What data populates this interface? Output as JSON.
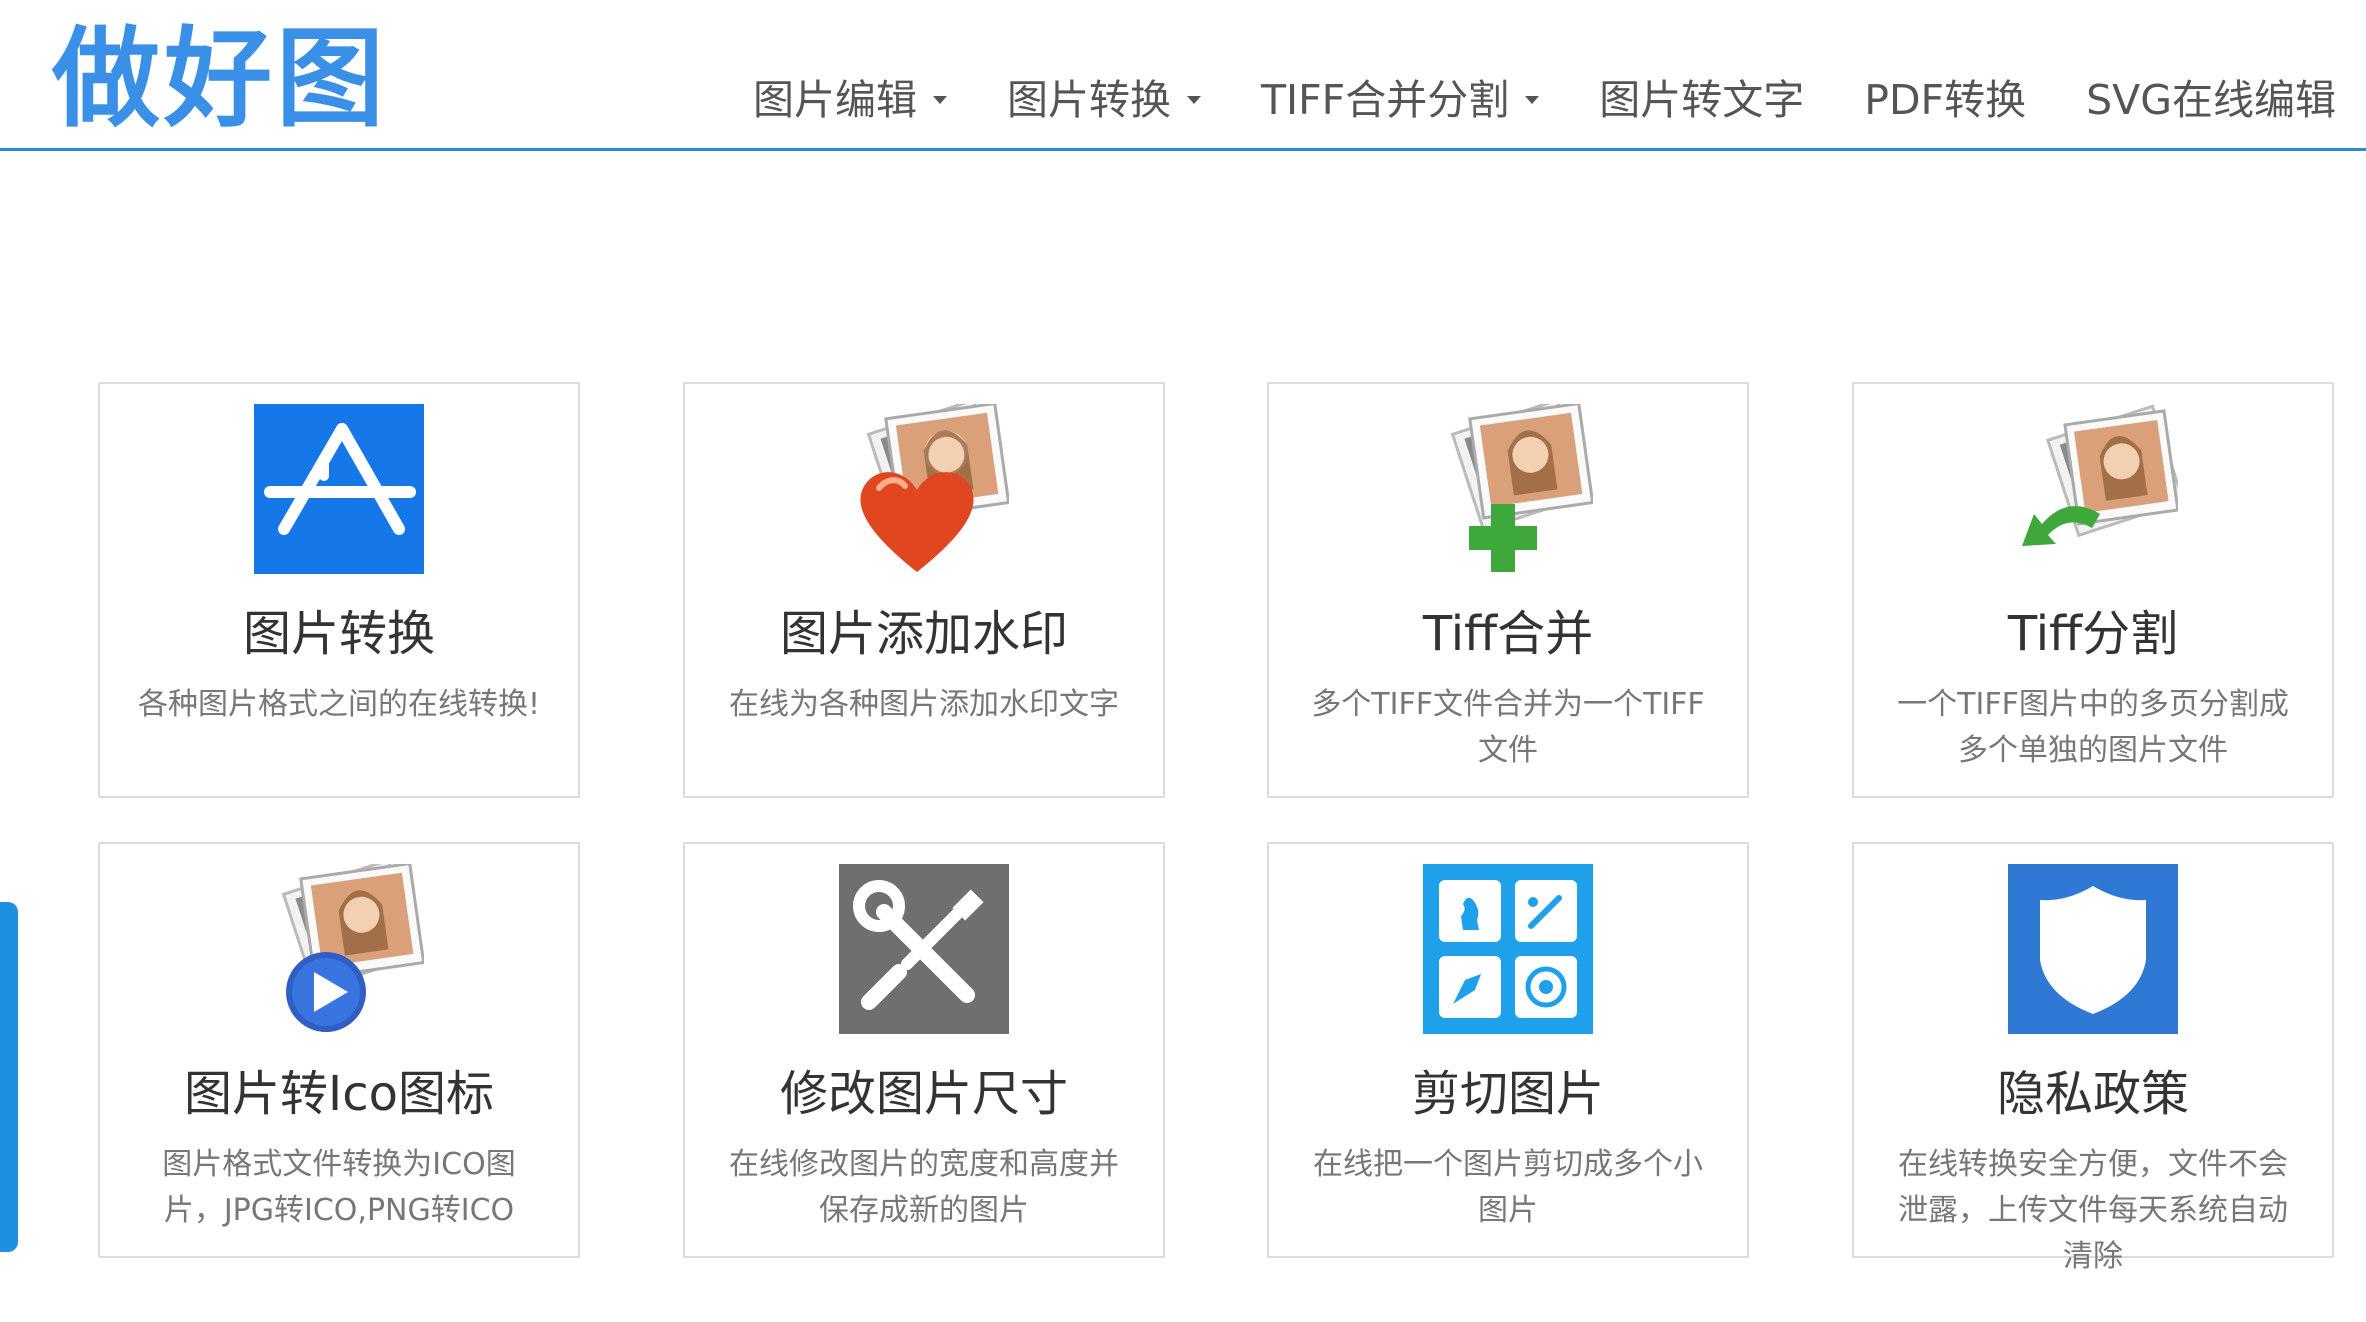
{
  "site": {
    "logo": "做好图",
    "accent_color": "#2d8ae0"
  },
  "nav": [
    {
      "label": "图片编辑",
      "dropdown": true
    },
    {
      "label": "图片转换",
      "dropdown": true
    },
    {
      "label": "TIFF合并分割",
      "dropdown": true
    },
    {
      "label": "图片转文字",
      "dropdown": false
    },
    {
      "label": "PDF转换",
      "dropdown": false
    },
    {
      "label": "SVG在线编辑",
      "dropdown": false
    }
  ],
  "cards": [
    {
      "icon": "app-store-icon",
      "title": "图片转换",
      "desc": "各种图片格式之间的在线转换!"
    },
    {
      "icon": "photo-heart-icon",
      "title": "图片添加水印",
      "desc": "在线为各种图片添加水印文字"
    },
    {
      "icon": "photo-plus-icon",
      "title": "Tiff合并",
      "desc": "多个TIFF文件合并为一个TIFF文件"
    },
    {
      "icon": "photo-split-icon",
      "title": "Tiff分割",
      "desc": "一个TIFF图片中的多页分割成多个单独的图片文件"
    },
    {
      "icon": "photo-play-icon",
      "title": "图片转Ico图标",
      "desc": "图片格式文件转换为ICO图片，JPG转ICO,PNG转ICO"
    },
    {
      "icon": "tools-icon",
      "title": "修改图片尺寸",
      "desc": "在线修改图片的宽度和高度并保存成新的图片"
    },
    {
      "icon": "crop-tiles-icon",
      "title": "剪切图片",
      "desc": "在线把一个图片剪切成多个小图片"
    },
    {
      "icon": "shield-icon",
      "title": "隐私政策",
      "desc": "在线转换安全方便，文件不会泄露，上传文件每天系统自动清除"
    }
  ]
}
